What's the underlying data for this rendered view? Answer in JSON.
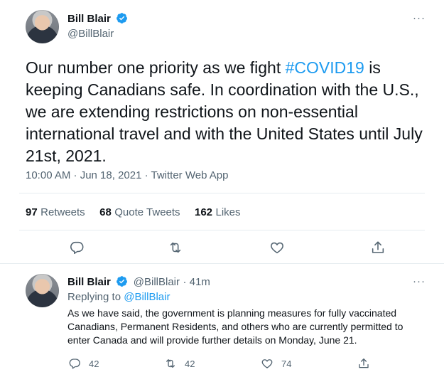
{
  "main_tweet": {
    "author_name": "Bill Blair",
    "handle": "@BillBlair",
    "more": "···",
    "text_before": "Our number one priority as we fight ",
    "hashtag": "#COVID19",
    "text_after": " is keeping Canadians safe. In coordination with the U.S., we are extending restrictions on non-essential international travel and with the United States until July 21st, 2021.",
    "meta": "10:00 AM · Jun 18, 2021 · Twitter Web App",
    "stats": {
      "retweets_count": "97",
      "retweets_label": "Retweets",
      "quotes_count": "68",
      "quotes_label": "Quote Tweets",
      "likes_count": "162",
      "likes_label": "Likes"
    }
  },
  "reply_tweet": {
    "author_name": "Bill Blair",
    "handle": "@BillBlair",
    "time": "· 41m",
    "more": "···",
    "replying_prefix": "Replying to ",
    "replying_to": "@BillBlair",
    "text": "As we have said, the government is planning measures for fully vaccinated Canadians, Permanent Residents, and others who are currently permitted to enter Canada and will provide further details on Monday, June 21.",
    "reply_count": "42",
    "retweet_count": "42",
    "like_count": "74"
  },
  "colors": {
    "accent": "#1d9bf0",
    "secondary_text": "#536471",
    "divider": "#e6ecf0"
  },
  "icons": [
    "verified-badge-icon",
    "more-icon",
    "reply-icon",
    "retweet-icon",
    "like-icon",
    "share-icon"
  ]
}
